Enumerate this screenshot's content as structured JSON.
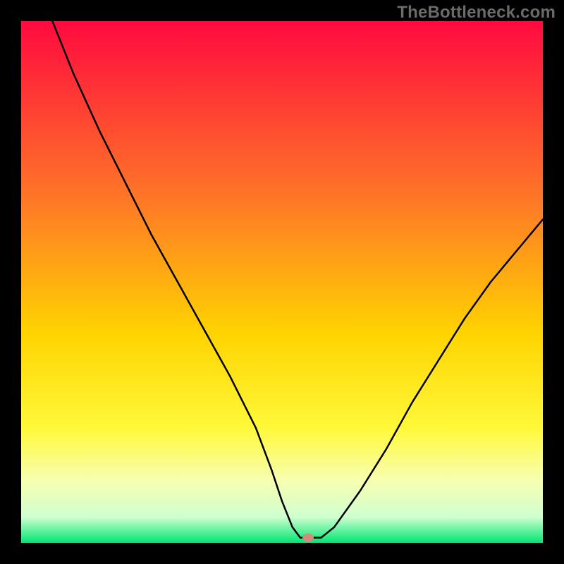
{
  "watermark": "TheBottleneck.com",
  "chart_data": {
    "type": "line",
    "title": "",
    "xlabel": "",
    "ylabel": "",
    "xlim": [
      0,
      100
    ],
    "ylim": [
      0,
      100
    ],
    "background_gradient": [
      {
        "stop": 0.0,
        "color": "#ff0a3f"
      },
      {
        "stop": 0.35,
        "color": "#ff7a26"
      },
      {
        "stop": 0.6,
        "color": "#ffd400"
      },
      {
        "stop": 0.78,
        "color": "#fff93a"
      },
      {
        "stop": 0.88,
        "color": "#f7ffb0"
      },
      {
        "stop": 0.95,
        "color": "#d0ffd0"
      },
      {
        "stop": 1.0,
        "color": "#00e673"
      }
    ],
    "series": [
      {
        "name": "bottleneck-curve",
        "color": "#000000",
        "stroke_width": 2.5,
        "x": [
          6,
          10,
          15,
          20,
          25,
          30,
          35,
          40,
          45,
          48,
          50,
          52,
          53.5,
          55,
          57.5,
          60,
          65,
          70,
          75,
          80,
          85,
          90,
          95,
          100
        ],
        "values": [
          100,
          90,
          79,
          69,
          59,
          50,
          41,
          32,
          22,
          14,
          8,
          3,
          1,
          1,
          1,
          3,
          10,
          18,
          27,
          35,
          43,
          50,
          56,
          62
        ]
      }
    ],
    "marker": {
      "name": "optimal-point",
      "x": 55,
      "y": 1,
      "color": "#d48b7a",
      "rx": 8,
      "ry": 6
    }
  }
}
